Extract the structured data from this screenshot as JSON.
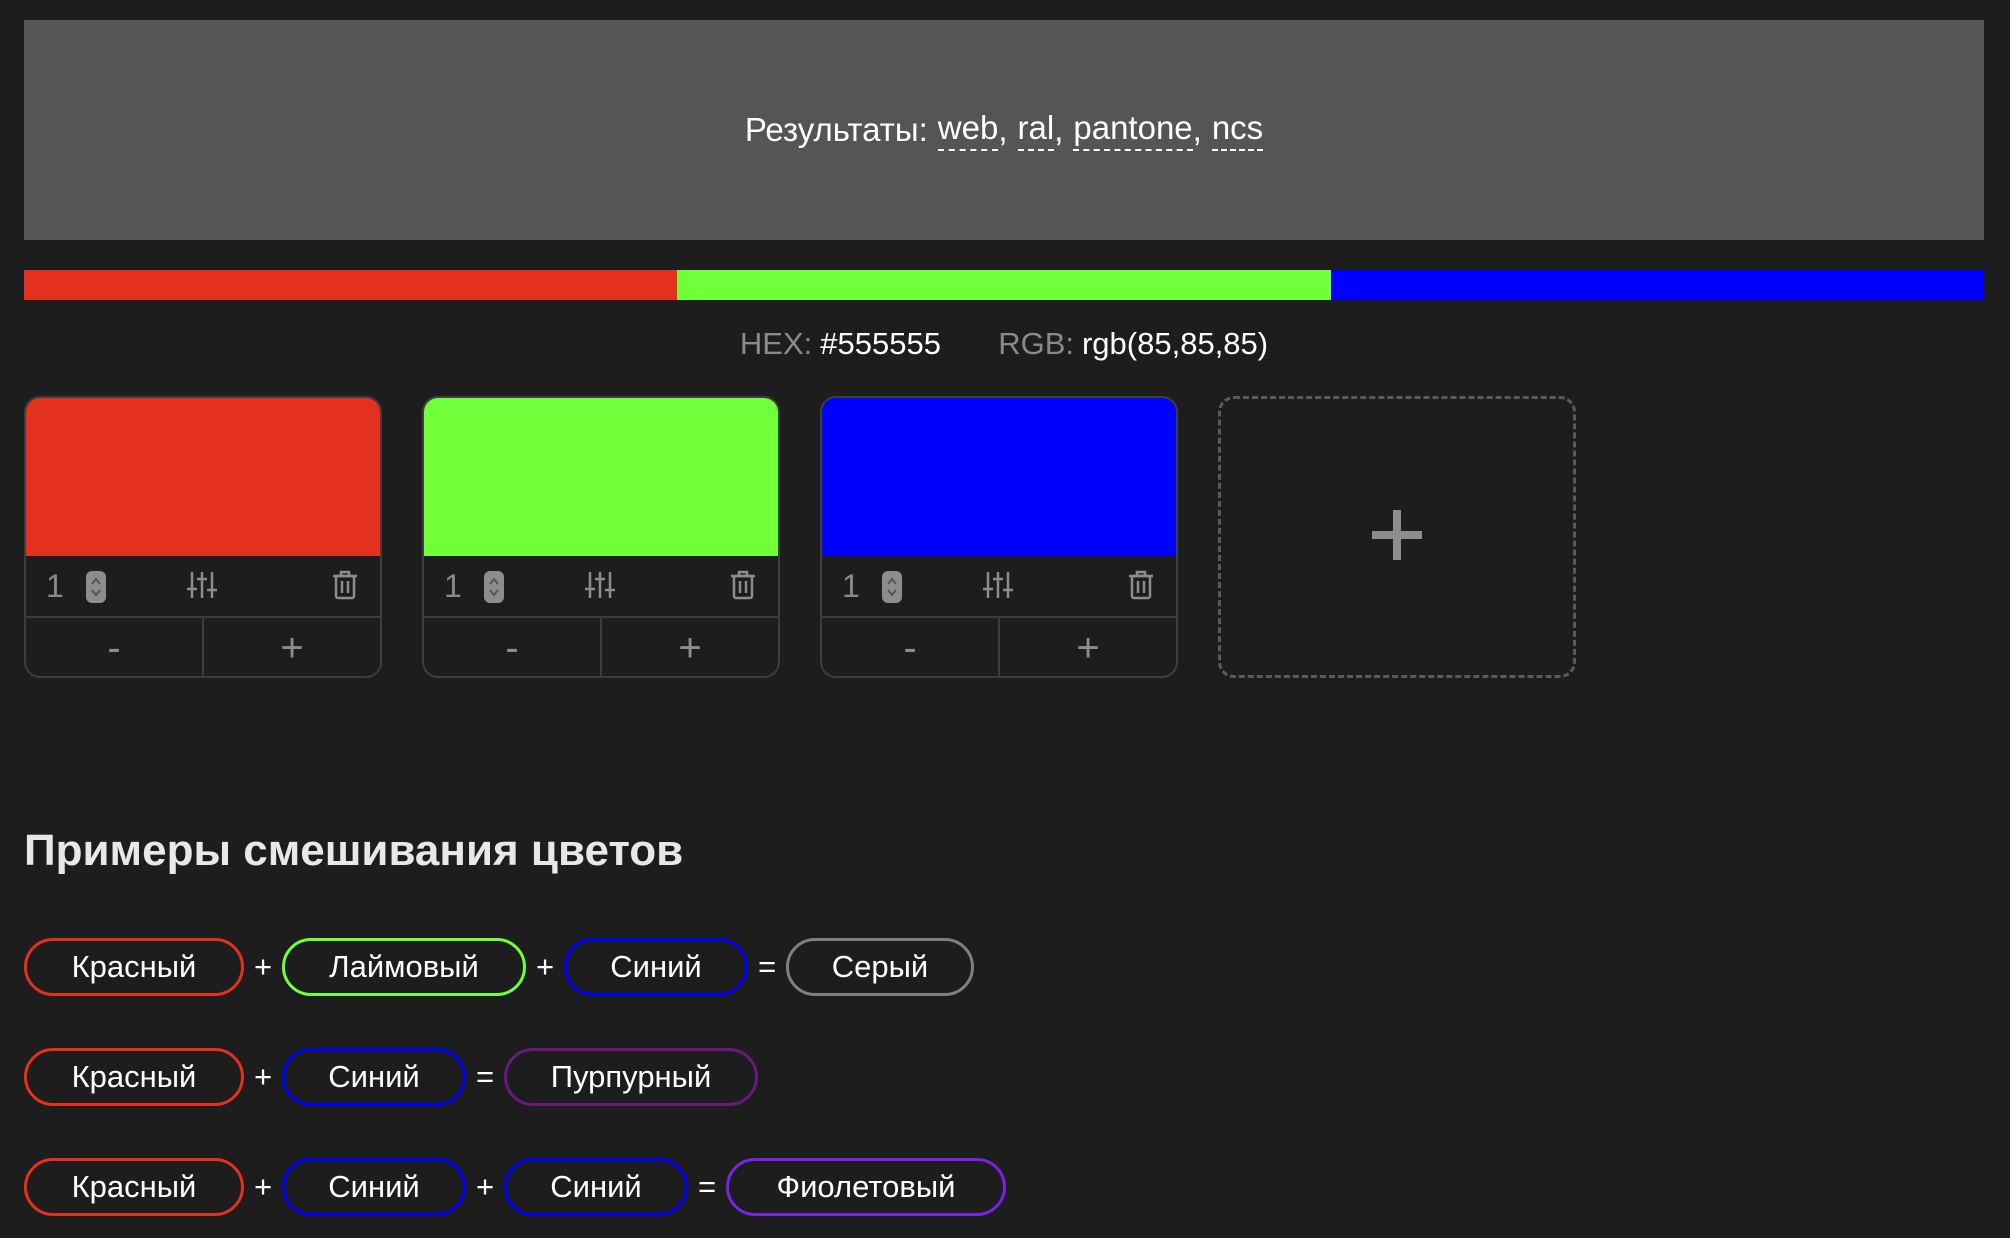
{
  "results": {
    "label": "Результаты:",
    "links": [
      "web",
      "ral",
      "pantone",
      "ncs"
    ]
  },
  "ratio_bar": [
    {
      "color": "#e4301e",
      "share": 1
    },
    {
      "color": "#71ff3a",
      "share": 1
    },
    {
      "color": "#0000ff",
      "share": 1
    }
  ],
  "codes": {
    "hex_label": "HEX:",
    "hex_value": "#555555",
    "rgb_label": "RGB:",
    "rgb_value": "rgb(85,85,85)"
  },
  "cards": [
    {
      "color": "#e4301e",
      "quantity": "1",
      "minus": "-",
      "plus": "+"
    },
    {
      "color": "#71ff3a",
      "quantity": "1",
      "minus": "-",
      "plus": "+"
    },
    {
      "color": "#0000ff",
      "quantity": "1",
      "minus": "-",
      "plus": "+"
    }
  ],
  "add_card": {
    "icon": "plus-icon"
  },
  "examples": {
    "title": "Примеры смешивания цветов",
    "rows": [
      {
        "inputs": [
          {
            "name": "Красный",
            "color": "#e4301e"
          },
          {
            "name": "Лаймовый",
            "color": "#71ff3a"
          },
          {
            "name": "Синий",
            "color": "#0000ff"
          }
        ],
        "plus": "+",
        "equals": "=",
        "result": {
          "name": "Серый",
          "color": "#808080"
        }
      },
      {
        "inputs": [
          {
            "name": "Красный",
            "color": "#e4301e"
          },
          {
            "name": "Синий",
            "color": "#0000ff"
          }
        ],
        "plus": "+",
        "equals": "=",
        "result": {
          "name": "Пурпурный",
          "color": "#6a1a7a"
        }
      },
      {
        "inputs": [
          {
            "name": "Красный",
            "color": "#e4301e"
          },
          {
            "name": "Синий",
            "color": "#0000ff"
          },
          {
            "name": "Синий",
            "color": "#0000ff"
          }
        ],
        "plus": "+",
        "equals": "=",
        "result": {
          "name": "Фиолетовый",
          "color": "#7a22e8"
        }
      }
    ]
  }
}
